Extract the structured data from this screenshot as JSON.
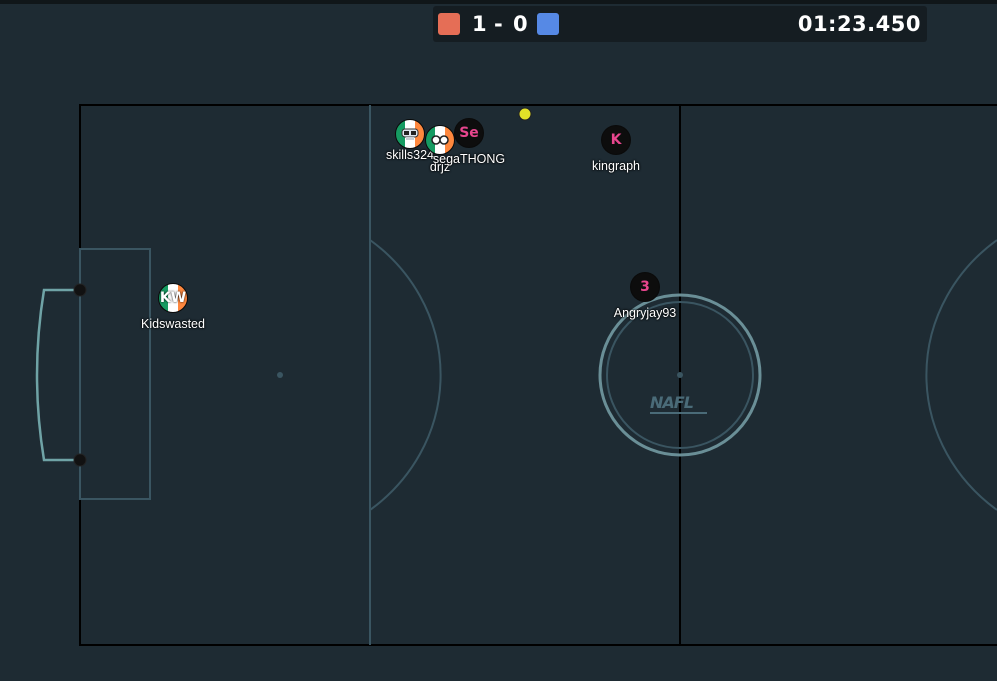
{
  "score": {
    "red_color": "#e56e56",
    "blue_color": "#5689e5",
    "red": "1",
    "separator": "-",
    "blue": "0"
  },
  "clock": "01:23.450",
  "players": [
    {
      "name": "skills324",
      "avatar": "flag-goggles",
      "team": "red"
    },
    {
      "name": "drjz",
      "avatar": "flag-eyes",
      "team": "red"
    },
    {
      "name": "segaTHONG",
      "avatar": "Se",
      "team": "red"
    },
    {
      "name": "kingraph",
      "avatar": "K",
      "team": "red"
    },
    {
      "name": "Kidswasted",
      "avatar": "KW",
      "team": "red"
    },
    {
      "name": "Angryjay93",
      "avatar": "3",
      "team": "red"
    }
  ],
  "ball": {
    "color": "#e2e228"
  },
  "pitch": {
    "logo": "NAFL"
  }
}
